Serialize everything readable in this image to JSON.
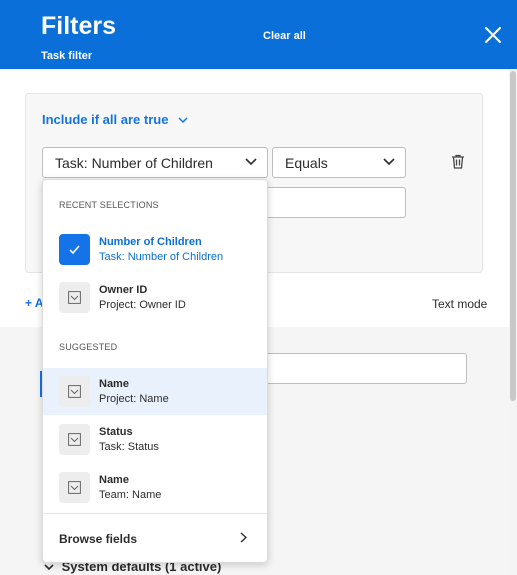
{
  "header": {
    "title": "Filters",
    "subtitle": "Task filter",
    "clear_all": "Clear all",
    "accent_color": "#0a6fd8"
  },
  "filter": {
    "include_label": "Include if all are true",
    "field_value": "Task: Number of Children",
    "operator_value": "Equals"
  },
  "actions": {
    "add_label": "+ A",
    "text_mode": "Text mode"
  },
  "lower": {
    "system_defaults": "System defaults (1 active)"
  },
  "dropdown": {
    "recent_heading": "RECENT SELECTIONS",
    "suggested_heading": "SUGGESTED",
    "recent": [
      {
        "name": "Number of Children",
        "source": "Task: Number of Children",
        "selected": true
      },
      {
        "name": "Owner ID",
        "source": "Project: Owner ID",
        "selected": false
      }
    ],
    "suggested": [
      {
        "name": "Name",
        "source": "Project: Name"
      },
      {
        "name": "Status",
        "source": "Task: Status"
      },
      {
        "name": "Name",
        "source": "Team: Name"
      }
    ],
    "browse_label": "Browse fields"
  }
}
